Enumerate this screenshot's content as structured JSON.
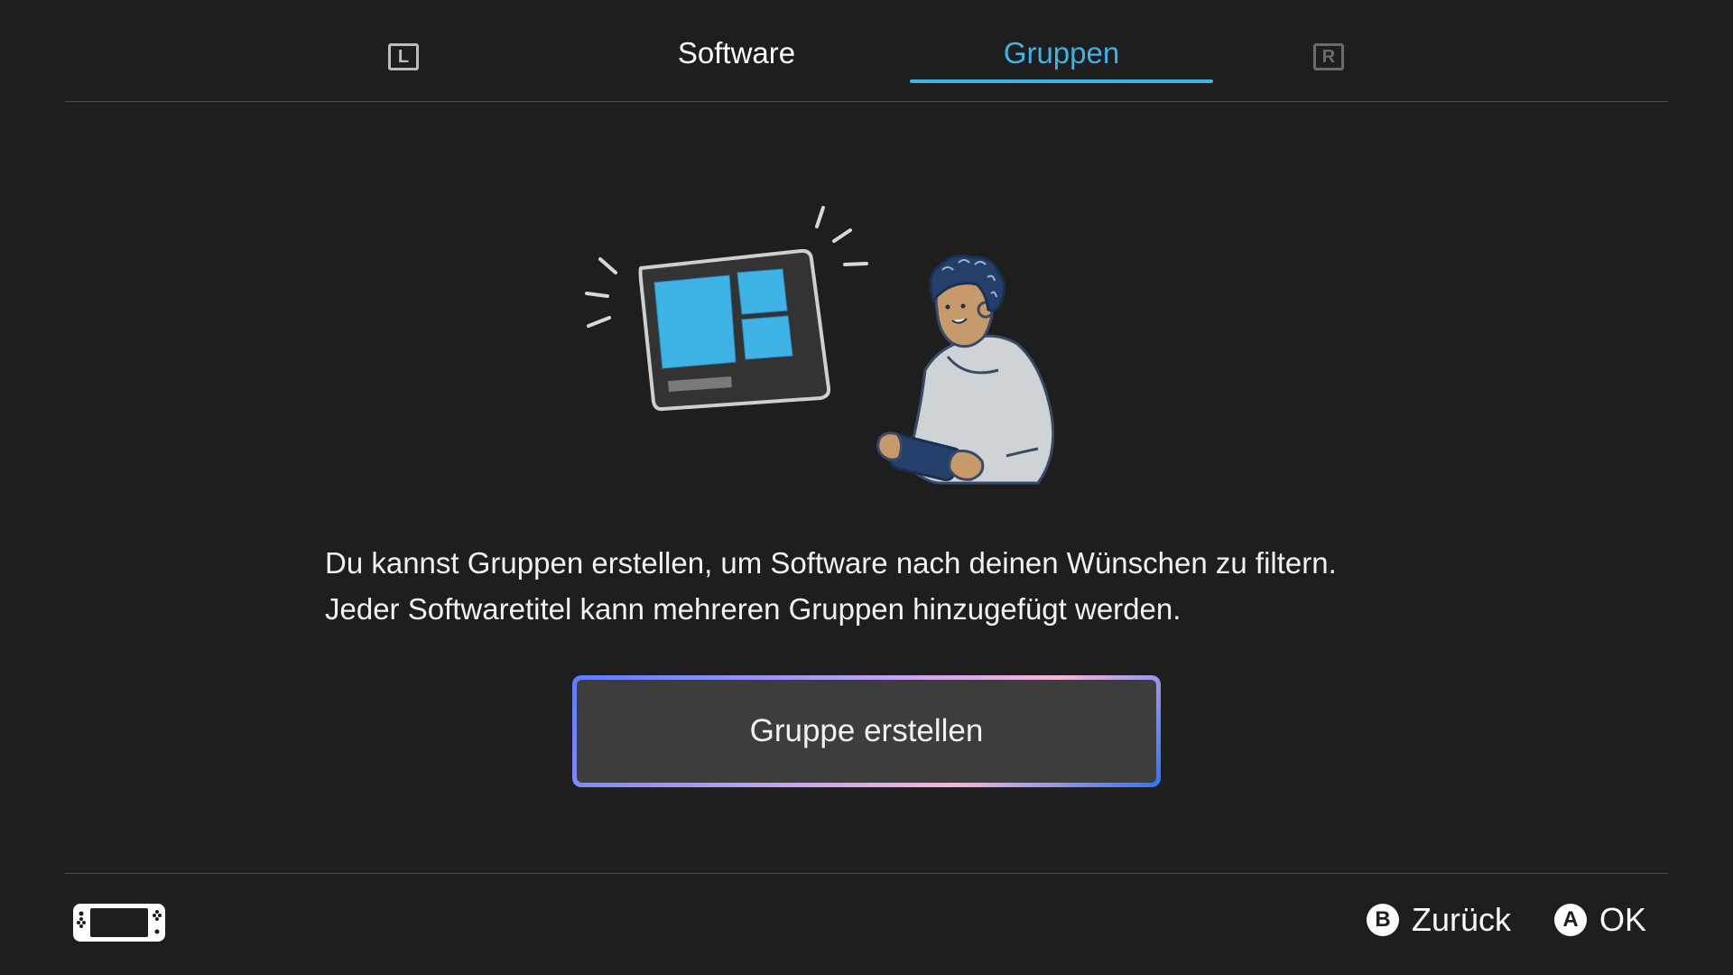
{
  "header": {
    "left_shoulder": "L",
    "right_shoulder": "R",
    "tabs": [
      {
        "label": "Software",
        "active": false
      },
      {
        "label": "Gruppen",
        "active": true
      }
    ]
  },
  "main": {
    "description_line1": "Du kannst Gruppen erstellen, um Software nach deinen Wünschen zu filtern.",
    "description_line2": "Jeder Softwaretitel kann mehreren Gruppen hinzugefügt werden.",
    "create_button_label": "Gruppe erstellen"
  },
  "footer": {
    "console_icon": "handheld-console-icon",
    "hints": [
      {
        "button": "B",
        "label": "Zurück"
      },
      {
        "button": "A",
        "label": "OK"
      }
    ]
  },
  "colors": {
    "background": "#1e1e1e",
    "accent": "#3fb2e6",
    "button_fill": "#3d3d3d"
  }
}
